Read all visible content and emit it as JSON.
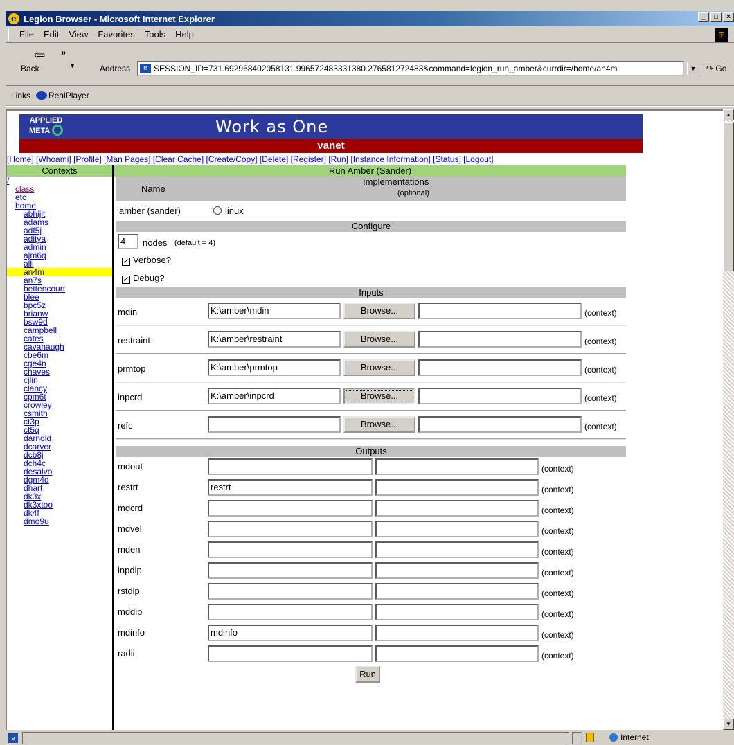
{
  "window": {
    "title": "Legion Browser - Microsoft Internet Explorer"
  },
  "menu": [
    "File",
    "Edit",
    "View",
    "Favorites",
    "Tools",
    "Help"
  ],
  "toolbar": {
    "back_label": "Back",
    "address_label": "Address",
    "address_value": "SESSION_ID=731.692968402058131.996572483331380.276581272483&command=legion_run_amber&currdir=/home/an4m",
    "go_label": "Go"
  },
  "links_bar": {
    "label": "Links",
    "realplayer": "RealPlayer"
  },
  "banner": {
    "logo_line1": "APPLIED",
    "logo_line2": "META",
    "slogan": "Work as One",
    "user": "vanet"
  },
  "nav": [
    "[Home]",
    "[Whoami]",
    "[Profile]",
    "[Man Pages]",
    "[Clear Cache]",
    "[Create/Copy]",
    "[Delete]",
    "[Register]",
    "[Run]",
    "[Instance Information]",
    "[Status]",
    "[Logout]"
  ],
  "contexts": {
    "header": "Contexts",
    "root": "/",
    "top": [
      "class",
      "etc",
      "home"
    ],
    "items": [
      "abhijit",
      "adams",
      "adf5j",
      "aditya",
      "admin",
      "ajm6q",
      "alli",
      "an4m",
      "an7s",
      "bettencourt",
      "blee",
      "bpc5z",
      "brianw",
      "bsw9d",
      "campbell",
      "cates",
      "cavanaugh",
      "cbe6m",
      "cge4n",
      "chaves",
      "cjlin",
      "clancy",
      "cpm6t",
      "crowley",
      "csmith",
      "ct3p",
      "ct5q",
      "darnold",
      "dcarver",
      "dcb8j",
      "dch4c",
      "desalvo",
      "dgm4d",
      "dhart",
      "dk3x",
      "dk3xtoo",
      "dk4f",
      "dmo9u"
    ],
    "selected": "an4m"
  },
  "run": {
    "header": "Run Amber (Sander)",
    "name_col": "Name",
    "impl_col": "Implementations",
    "impl_sub": "(optional)",
    "program": "amber (sander)",
    "platform": "linux",
    "configure_header": "Configure",
    "nodes_value": "4",
    "nodes_label": "nodes",
    "nodes_default": "(default = 4)",
    "verbose_label": "Verbose?",
    "debug_label": "Debug?",
    "inputs_header": "Inputs",
    "outputs_header": "Outputs",
    "browse_label": "Browse...",
    "context_label": "(context)",
    "run_label": "Run",
    "inputs": [
      {
        "name": "mdin",
        "value": "K:\\amber\\mdin"
      },
      {
        "name": "restraint",
        "value": "K:\\amber\\restraint"
      },
      {
        "name": "prmtop",
        "value": "K:\\amber\\prmtop"
      },
      {
        "name": "inpcrd",
        "value": "K:\\amber\\inpcrd"
      },
      {
        "name": "refc",
        "value": ""
      }
    ],
    "outputs": [
      {
        "name": "mdout",
        "value": ""
      },
      {
        "name": "restrt",
        "value": "restrt"
      },
      {
        "name": "mdcrd",
        "value": ""
      },
      {
        "name": "mdvel",
        "value": ""
      },
      {
        "name": "mden",
        "value": ""
      },
      {
        "name": "inpdip",
        "value": ""
      },
      {
        "name": "rstdip",
        "value": ""
      },
      {
        "name": "mddip",
        "value": ""
      },
      {
        "name": "mdinfo",
        "value": "mdinfo"
      },
      {
        "name": "radii",
        "value": ""
      }
    ]
  },
  "status": {
    "zone": "Internet"
  }
}
